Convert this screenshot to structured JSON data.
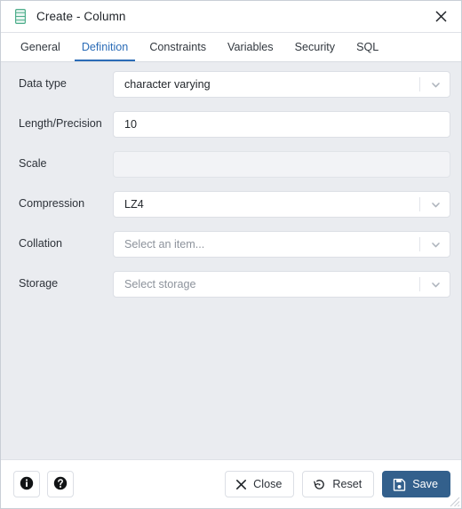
{
  "window": {
    "title": "Create - Column",
    "icon": "column-icon",
    "close_label": "×"
  },
  "tabs": [
    {
      "label": "General",
      "active": false
    },
    {
      "label": "Definition",
      "active": true
    },
    {
      "label": "Constraints",
      "active": false
    },
    {
      "label": "Variables",
      "active": false
    },
    {
      "label": "Security",
      "active": false
    },
    {
      "label": "SQL",
      "active": false
    }
  ],
  "fields": {
    "data_type": {
      "label": "Data type",
      "value": "character varying",
      "type": "select",
      "disabled": false
    },
    "length_precision": {
      "label": "Length/Precision",
      "value": "10",
      "type": "text",
      "disabled": false
    },
    "scale": {
      "label": "Scale",
      "value": "",
      "type": "text",
      "disabled": true
    },
    "compression": {
      "label": "Compression",
      "value": "LZ4",
      "type": "select",
      "disabled": false
    },
    "collation": {
      "label": "Collation",
      "value": "",
      "placeholder": "Select an item...",
      "type": "select",
      "disabled": false
    },
    "storage": {
      "label": "Storage",
      "value": "",
      "placeholder": "Select storage",
      "type": "select",
      "disabled": false
    }
  },
  "footer": {
    "info_icon": "info-icon",
    "help_icon": "help-icon",
    "close_label": "Close",
    "reset_label": "Reset",
    "save_label": "Save"
  },
  "colors": {
    "accent": "#2b6cb7",
    "primary_button": "#33608c",
    "body_background": "#eaecf0",
    "panel_background": "#ffffff",
    "icon_green": "#5fbc9a"
  }
}
